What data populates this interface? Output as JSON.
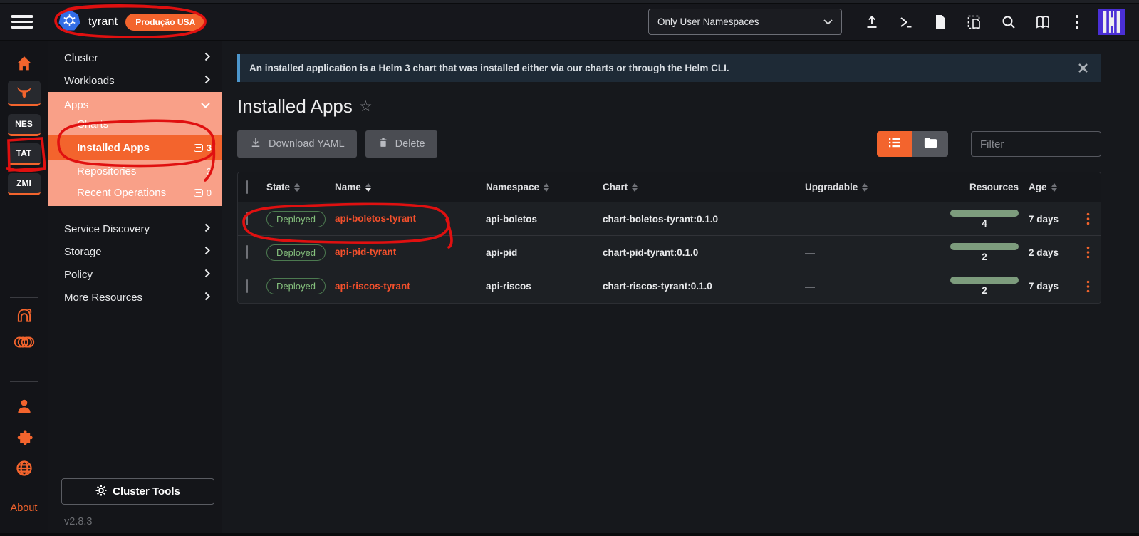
{
  "colors": {
    "accent": "#f3642d",
    "annotation": "#e01010",
    "deployed_green": "#85c07d",
    "salmon": "#f9a088"
  },
  "header": {
    "cluster_name": "tyrant",
    "env_badge": "Produção USA",
    "namespace_filter": "Only User Namespaces"
  },
  "rail": {
    "projects": [
      "NES",
      "TAT",
      "ZMI"
    ],
    "about": "About"
  },
  "sidebar": {
    "items": [
      {
        "label": "Cluster"
      },
      {
        "label": "Workloads"
      },
      {
        "label": "Apps"
      },
      {
        "label": "Service Discovery"
      },
      {
        "label": "Storage"
      },
      {
        "label": "Policy"
      },
      {
        "label": "More Resources"
      }
    ],
    "apps_children": [
      {
        "label": "Charts",
        "count": ""
      },
      {
        "label": "Installed Apps",
        "count": "3"
      },
      {
        "label": "Repositories",
        "count": "3"
      },
      {
        "label": "Recent Operations",
        "count": "0"
      }
    ],
    "cluster_tools": "Cluster Tools",
    "version": "v2.8.3"
  },
  "main": {
    "banner_text": "An installed application is a Helm 3 chart that was installed either via our charts or through the Helm CLI.",
    "title": "Installed Apps",
    "download_yaml": "Download YAML",
    "delete": "Delete",
    "filter_placeholder": "Filter",
    "table": {
      "headers": [
        "State",
        "Name",
        "Namespace",
        "Chart",
        "Upgradable",
        "Resources",
        "Age"
      ],
      "rows": [
        {
          "state": "Deployed",
          "name": "api-boletos-tyrant",
          "namespace": "api-boletos",
          "chart": "chart-boletos-tyrant:0.1.0",
          "upgradable": "—",
          "resources": "4",
          "age": "7 days"
        },
        {
          "state": "Deployed",
          "name": "api-pid-tyrant",
          "namespace": "api-pid",
          "chart": "chart-pid-tyrant:0.1.0",
          "upgradable": "—",
          "resources": "2",
          "age": "2 days"
        },
        {
          "state": "Deployed",
          "name": "api-riscos-tyrant",
          "namespace": "api-riscos",
          "chart": "chart-riscos-tyrant:0.1.0",
          "upgradable": "—",
          "resources": "2",
          "age": "7 days"
        }
      ]
    }
  }
}
